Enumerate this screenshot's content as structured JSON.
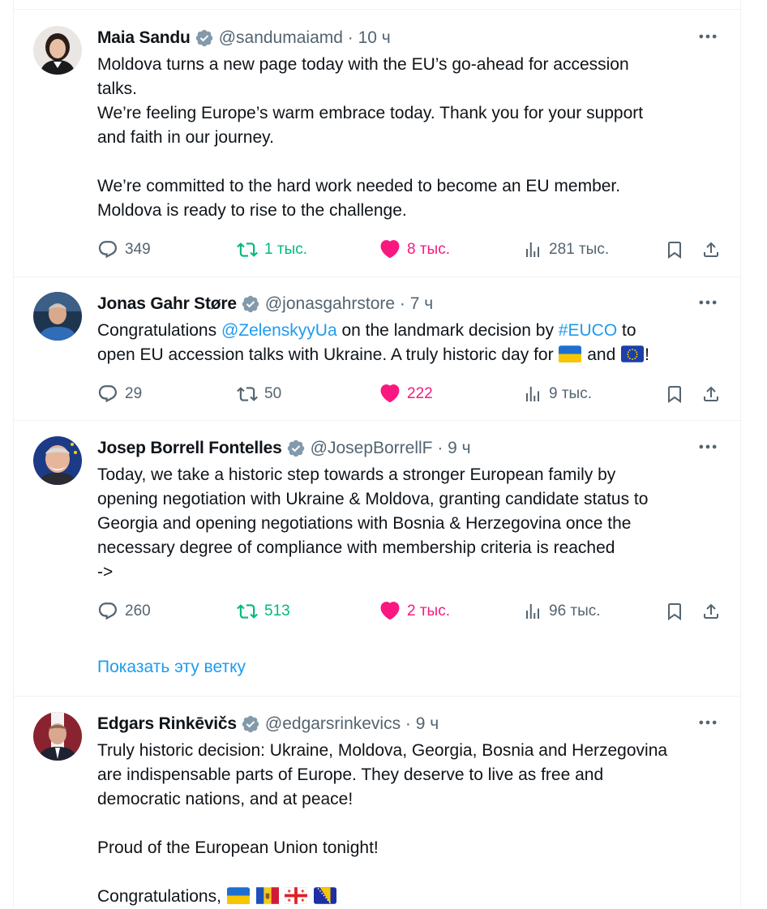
{
  "tweets": [
    {
      "name": "Maia Sandu",
      "handle": "@sandumaiamd",
      "time": "10 ч",
      "meta": "@sandumaiamd · 10 ч",
      "lines": [
        "Moldova turns a new page today with the EU’s go-ahead for accession",
        "talks.",
        "We’re feeling Europe’s warm embrace today. Thank you for your support",
        "and faith in our journey.",
        "",
        "We’re committed to the hard work needed to become an EU member.",
        "Moldova is ready to rise to the challenge."
      ],
      "replies": "349",
      "retweets": "1 тыс.",
      "likes": "8 тыс.",
      "views": "281 тыс.",
      "retweeted": true,
      "liked": true
    },
    {
      "name": "Jonas Gahr Støre",
      "handle": "@jonasgahrstore",
      "time": "7 ч",
      "meta": "@jonasgahrstore · 7 ч",
      "line1_a": "Congratulations ",
      "line1_mention": "@ZelenskyyUa",
      "line1_b": " on the landmark decision by ",
      "line1_hashtag": "#EUCO",
      "line1_c": " to",
      "line2_a": "open EU accession talks with Ukraine. A truly historic day for ",
      "line2_b": " and ",
      "line2_c": "!",
      "replies": "29",
      "retweets": "50",
      "likes": "222",
      "views": "9 тыс.",
      "retweeted": false,
      "liked": true
    },
    {
      "name": "Josep Borrell Fontelles",
      "handle": "@JosepBorrellF",
      "time": "9 ч",
      "meta": "@JosepBorrellF · 9 ч",
      "lines": [
        "Today, we take a historic step towards a stronger European family by",
        "opening negotiation with Ukraine & Moldova, granting candidate status to",
        "Georgia and opening negotiations with Bosnia & Herzegovina once the",
        "necessary degree of compliance with membership criteria is reached",
        "->"
      ],
      "replies": "260",
      "retweets": "513",
      "likes": "2 тыс.",
      "views": "96 тыс.",
      "retweeted": true,
      "liked": true,
      "show_thread": "Показать эту ветку"
    },
    {
      "name": "Edgars Rinkēvičs",
      "handle": "@edgarsrinkevics",
      "time": "9 ч",
      "meta": "@edgarsrinkevics · 9 ч",
      "lines": [
        "Truly historic decision: Ukraine, Moldova, Georgia, Bosnia and Herzegovina",
        "are indispensable parts of Europe. They deserve to live as free and",
        "democratic nations, and at peace!",
        "",
        "Proud of the European Union tonight!",
        ""
      ],
      "last_line": "Congratulations, "
    }
  ],
  "icons": {
    "reply": "reply-icon",
    "retweet": "retweet-icon",
    "like": "heart-icon",
    "views": "views-icon",
    "bookmark": "bookmark-icon",
    "share": "share-icon",
    "more": "more-icon",
    "verified": "verified-badge-icon"
  },
  "colors": {
    "link": "#1d9bf0",
    "retweet_active": "#00ba7c",
    "like_active": "#f91880",
    "muted": "#536471",
    "verified_badge": "#829aab"
  }
}
